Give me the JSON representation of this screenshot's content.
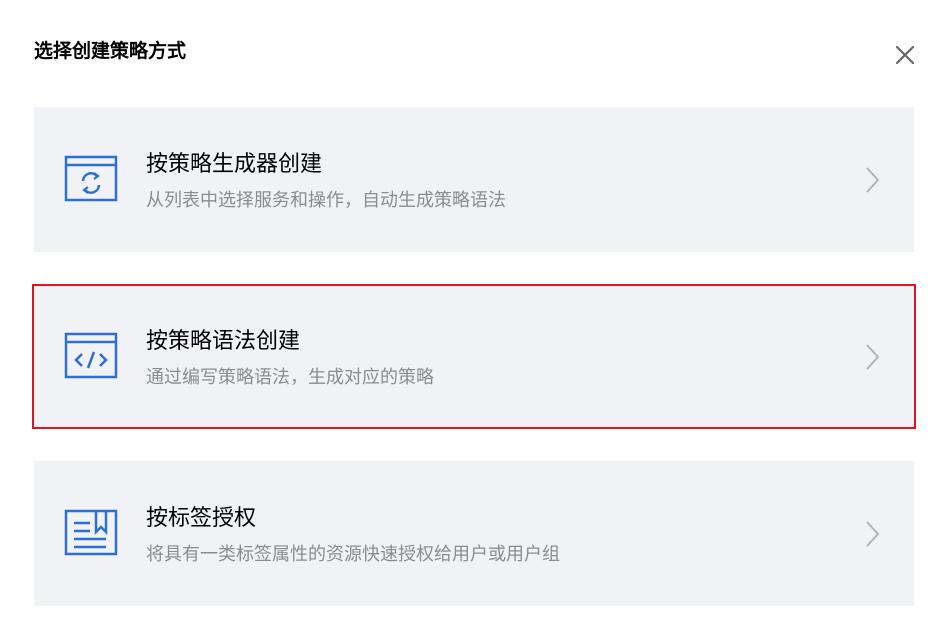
{
  "dialog": {
    "title": "选择创建策略方式",
    "close_icon": "close-icon"
  },
  "options": [
    {
      "title": "按策略生成器创建",
      "description": "从列表中选择服务和操作，自动生成策略语法",
      "icon": "policy-generator-icon",
      "selected": false
    },
    {
      "title": "按策略语法创建",
      "description": "通过编写策略语法，生成对应的策略",
      "icon": "code-syntax-icon",
      "selected": true
    },
    {
      "title": "按标签授权",
      "description": "将具有一类标签属性的资源快速授权给用户或用户组",
      "icon": "tag-authorize-icon",
      "selected": false
    }
  ],
  "colors": {
    "accent": "#2e6fd6",
    "card_background": "#f0f2f5",
    "selected_border": "#e0141e",
    "description_text": "#8c8c8c"
  }
}
